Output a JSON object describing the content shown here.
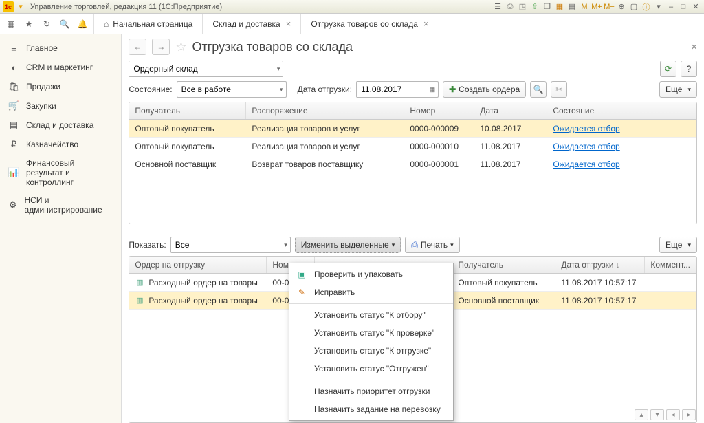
{
  "titlebar": {
    "app_icon": "1c",
    "text": "Управление торговлей, редакция 11  (1С:Предприятие)"
  },
  "tabs": {
    "home": "Начальная страница",
    "t1": "Склад и доставка",
    "t2": "Отгрузка товаров со склада"
  },
  "sidebar": {
    "items": [
      {
        "label": "Главное"
      },
      {
        "label": "CRM и маркетинг"
      },
      {
        "label": "Продажи"
      },
      {
        "label": "Закупки"
      },
      {
        "label": "Склад и доставка"
      },
      {
        "label": "Казначейство"
      },
      {
        "label": "Финансовый результат и контроллинг"
      },
      {
        "label": "НСИ и администрирование"
      }
    ]
  },
  "page": {
    "title": "Отгрузка товаров со склада",
    "warehouse": "Ордерный склад",
    "state_label": "Состояние:",
    "state_value": "Все в работе",
    "date_label": "Дата отгрузки:",
    "date_value": "11.08.2017",
    "create_btn": "Создать ордера",
    "more_btn": "Еще"
  },
  "grid1": {
    "headers": {
      "c1": "Получатель",
      "c2": "Распоряжение",
      "c3": "Номер",
      "c4": "Дата",
      "c5": "Состояние"
    },
    "rows": [
      {
        "c1": "Оптовый покупатель",
        "c2": "Реализация товаров и услуг",
        "c3": "0000-000009",
        "c4": "10.08.2017",
        "c5": "Ожидается отбор",
        "sel": true
      },
      {
        "c1": "Оптовый покупатель",
        "c2": "Реализация товаров и услуг",
        "c3": "0000-000010",
        "c4": "11.08.2017",
        "c5": "Ожидается отбор"
      },
      {
        "c1": "Основной поставщик",
        "c2": "Возврат товаров поставщику",
        "c3": "0000-000001",
        "c4": "11.08.2017",
        "c5": "Ожидается отбор"
      }
    ]
  },
  "lower": {
    "show_label": "Показать:",
    "show_value": "Все",
    "change_btn": "Изменить выделенные",
    "print_btn": "Печать",
    "more_btn": "Еще"
  },
  "grid2": {
    "headers": {
      "c1": "Ордер на отгрузку",
      "c2": "Ном...",
      "c3": "",
      "c4": "Получатель",
      "c5": "Дата отгрузки",
      "c6": "Коммент..."
    },
    "rows": [
      {
        "c1": "Расходный ордер на товары",
        "c2": "00-0",
        "c3": "",
        "c4": "Оптовый покупатель",
        "c5": "11.08.2017 10:57:17"
      },
      {
        "c1": "Расходный ордер на товары",
        "c2": "00-0",
        "c3": "",
        "c4": "Основной поставщик",
        "c5": "11.08.2017 10:57:17",
        "sel": true
      }
    ]
  },
  "menu": {
    "items": [
      {
        "label": "Проверить и упаковать",
        "icon": "check"
      },
      {
        "label": "Исправить",
        "icon": "edit"
      },
      {
        "sep": true
      },
      {
        "label": "Установить статус \"К отбору\""
      },
      {
        "label": "Установить статус \"К проверке\""
      },
      {
        "label": "Установить статус \"К отгрузке\""
      },
      {
        "label": "Установить статус \"Отгружен\""
      },
      {
        "sep": true
      },
      {
        "label": "Назначить приоритет отгрузки"
      },
      {
        "label": "Назначить задание на перевозку"
      }
    ]
  }
}
